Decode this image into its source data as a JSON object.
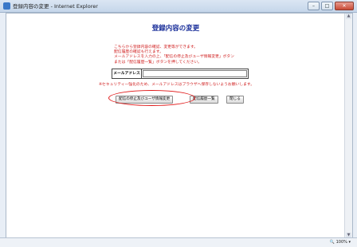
{
  "window": {
    "title": "登録内容の変更 - Internet Explorer",
    "minimize": "–",
    "maximize": "□",
    "close": "✕"
  },
  "page": {
    "heading": "登録内容の変更",
    "intro_lines": [
      "こちらから登録内容の確認、変更等ができます。",
      "配信履歴の確認も行えます。",
      "メールアドレスを入力の上、「配信の停止及びユーザ情報変更」ボタン",
      "または「配信履歴一覧」ボタンを押してください。"
    ],
    "email_label": "メールアドレス",
    "email_value": "",
    "notice": "※セキュリティー強化のため、メールアドレスはブラウザへ保存しないようお願いします。",
    "buttons": {
      "stop_and_change": "配信の停止及びユーザ情報変更",
      "history": "配信履歴一覧",
      "close": "閉じる"
    }
  },
  "status": {
    "zoom": "100%"
  },
  "icons": {
    "scroll_up": "▲",
    "scroll_down": "▼",
    "zoom": "🔍"
  },
  "colors": {
    "heading": "#1a2f9a",
    "intro_text": "#d02020",
    "highlight_circle": "#e01818"
  }
}
